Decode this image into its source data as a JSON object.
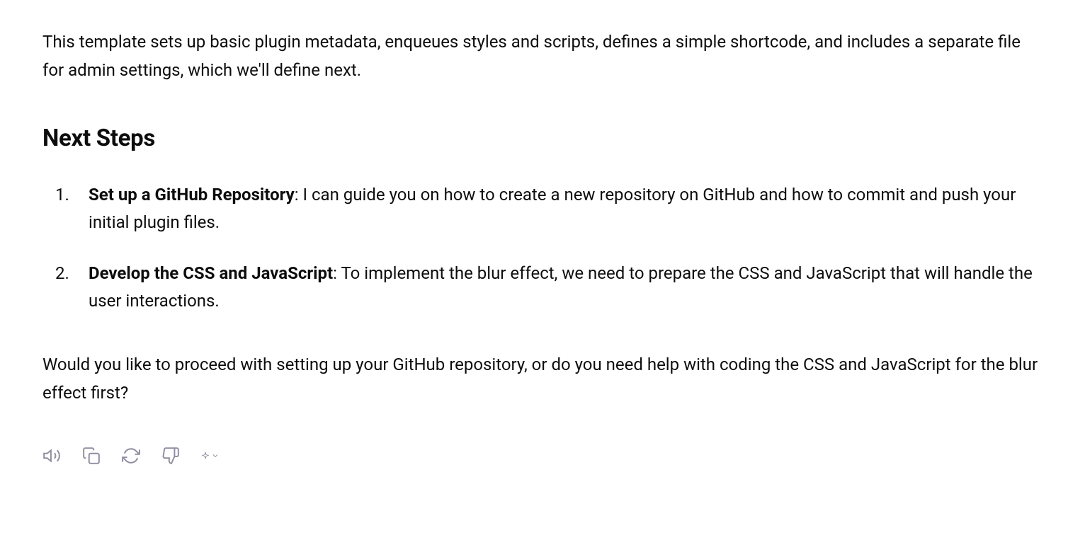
{
  "intro": "This template sets up basic plugin metadata, enqueues styles and scripts, defines a simple shortcode, and includes a separate file for admin settings, which we'll define next.",
  "heading": "Next Steps",
  "steps": [
    {
      "title": "Set up a GitHub Repository",
      "body": ": I can guide you on how to create a new repository on GitHub and how to commit and push your initial plugin files."
    },
    {
      "title": "Develop the CSS and JavaScript",
      "body": ": To implement the blur effect, we need to prepare the CSS and JavaScript that will handle the user interactions."
    }
  ],
  "closing": "Would you like to proceed with setting up your GitHub repository, or do you need help with coding the CSS and JavaScript for the blur effect first?"
}
